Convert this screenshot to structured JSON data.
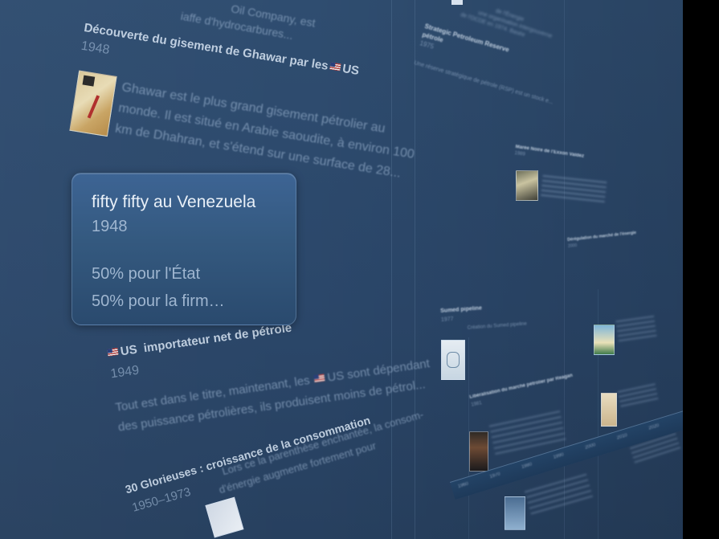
{
  "events": {
    "top_fragment": {
      "line1": "Oil Company, est",
      "line2": "iaffe d'hydrocarbures..."
    },
    "ghawar": {
      "title": "Découverte du gisement de Ghawar par les",
      "country": "US",
      "year": "1948",
      "text_line1": "Ghawar est le plus grand gisement pétrolier au",
      "text_line2": "monde. Il est situé en Arabie saoudite, à environ 100",
      "text_line3": "km de Dhahran, et s'étend sur une surface de 28..."
    },
    "us_importer": {
      "country": "US",
      "title": "importateur net de pétrole",
      "year": "1949",
      "text_line1_a": "Tout est dans le titre, maintenant, les",
      "text_line1_country": "US",
      "text_line1_b": "sont dépendant",
      "text_line2": "des puissance pétrolières, ils produisent moins de pétrol..."
    },
    "glorieuses": {
      "title": "30 Glorieuses : croissance de la consommation",
      "years": "1950–1973",
      "text_line1": "Lors ce la parenthèse enchantée, la consom-",
      "text_line2": "d'énergie augmente fortement pour"
    },
    "spr": {
      "title_line1": "Strategic Petroleum Reserve",
      "title_line2": "pétrole",
      "year": "1975",
      "text": "Une réserve stratégique de pétrole (RSP) est un stock e..."
    },
    "top_right_fragment": {
      "line1": "de l'Énergie",
      "line2": "une organisation intergouverne",
      "line3": "de l'OCDE en 1974. Basée"
    },
    "marie_rose": {
      "title": "Marée Noire de l'Exxon Valdez",
      "year": "1989"
    },
    "sumed": {
      "title": "Sumed pipeline",
      "year": "1977",
      "text": "Création du Sumed pipeline"
    },
    "liberalisation": {
      "title": "Libéralisation du marché pétrolier par Reagan",
      "year": "1981"
    },
    "deregulation": {
      "title": "Dérégulation du marché de l'énergie",
      "year": "2000"
    },
    "deepwater": {
      "year": "2010"
    }
  },
  "popup": {
    "title": "fifty fifty au Venezuela",
    "year": "1948",
    "line1": "50% pour l'État",
    "line2": "50% pour la firm…"
  },
  "timeline_ticks": [
    "1960",
    "1970",
    "1980",
    "1990",
    "2000",
    "2010",
    "2020"
  ],
  "colors": {
    "wall": "#2b476a",
    "popup_top": "#3d6494",
    "popup_bottom": "#2a4a6e",
    "popup_title": "#e9f0f8",
    "popup_text": "#9fb6d0"
  }
}
